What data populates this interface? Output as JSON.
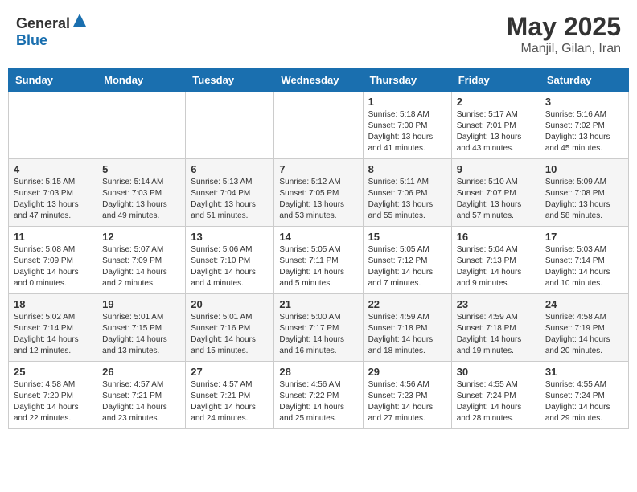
{
  "header": {
    "logo_general": "General",
    "logo_blue": "Blue",
    "month": "May 2025",
    "location": "Manjil, Gilan, Iran"
  },
  "days_of_week": [
    "Sunday",
    "Monday",
    "Tuesday",
    "Wednesday",
    "Thursday",
    "Friday",
    "Saturday"
  ],
  "weeks": [
    [
      {
        "day": "",
        "sunrise": "",
        "sunset": "",
        "daylight": ""
      },
      {
        "day": "",
        "sunrise": "",
        "sunset": "",
        "daylight": ""
      },
      {
        "day": "",
        "sunrise": "",
        "sunset": "",
        "daylight": ""
      },
      {
        "day": "",
        "sunrise": "",
        "sunset": "",
        "daylight": ""
      },
      {
        "day": "1",
        "sunrise": "Sunrise: 5:18 AM",
        "sunset": "Sunset: 7:00 PM",
        "daylight": "Daylight: 13 hours and 41 minutes."
      },
      {
        "day": "2",
        "sunrise": "Sunrise: 5:17 AM",
        "sunset": "Sunset: 7:01 PM",
        "daylight": "Daylight: 13 hours and 43 minutes."
      },
      {
        "day": "3",
        "sunrise": "Sunrise: 5:16 AM",
        "sunset": "Sunset: 7:02 PM",
        "daylight": "Daylight: 13 hours and 45 minutes."
      }
    ],
    [
      {
        "day": "4",
        "sunrise": "Sunrise: 5:15 AM",
        "sunset": "Sunset: 7:03 PM",
        "daylight": "Daylight: 13 hours and 47 minutes."
      },
      {
        "day": "5",
        "sunrise": "Sunrise: 5:14 AM",
        "sunset": "Sunset: 7:03 PM",
        "daylight": "Daylight: 13 hours and 49 minutes."
      },
      {
        "day": "6",
        "sunrise": "Sunrise: 5:13 AM",
        "sunset": "Sunset: 7:04 PM",
        "daylight": "Daylight: 13 hours and 51 minutes."
      },
      {
        "day": "7",
        "sunrise": "Sunrise: 5:12 AM",
        "sunset": "Sunset: 7:05 PM",
        "daylight": "Daylight: 13 hours and 53 minutes."
      },
      {
        "day": "8",
        "sunrise": "Sunrise: 5:11 AM",
        "sunset": "Sunset: 7:06 PM",
        "daylight": "Daylight: 13 hours and 55 minutes."
      },
      {
        "day": "9",
        "sunrise": "Sunrise: 5:10 AM",
        "sunset": "Sunset: 7:07 PM",
        "daylight": "Daylight: 13 hours and 57 minutes."
      },
      {
        "day": "10",
        "sunrise": "Sunrise: 5:09 AM",
        "sunset": "Sunset: 7:08 PM",
        "daylight": "Daylight: 13 hours and 58 minutes."
      }
    ],
    [
      {
        "day": "11",
        "sunrise": "Sunrise: 5:08 AM",
        "sunset": "Sunset: 7:09 PM",
        "daylight": "Daylight: 14 hours and 0 minutes."
      },
      {
        "day": "12",
        "sunrise": "Sunrise: 5:07 AM",
        "sunset": "Sunset: 7:09 PM",
        "daylight": "Daylight: 14 hours and 2 minutes."
      },
      {
        "day": "13",
        "sunrise": "Sunrise: 5:06 AM",
        "sunset": "Sunset: 7:10 PM",
        "daylight": "Daylight: 14 hours and 4 minutes."
      },
      {
        "day": "14",
        "sunrise": "Sunrise: 5:05 AM",
        "sunset": "Sunset: 7:11 PM",
        "daylight": "Daylight: 14 hours and 5 minutes."
      },
      {
        "day": "15",
        "sunrise": "Sunrise: 5:05 AM",
        "sunset": "Sunset: 7:12 PM",
        "daylight": "Daylight: 14 hours and 7 minutes."
      },
      {
        "day": "16",
        "sunrise": "Sunrise: 5:04 AM",
        "sunset": "Sunset: 7:13 PM",
        "daylight": "Daylight: 14 hours and 9 minutes."
      },
      {
        "day": "17",
        "sunrise": "Sunrise: 5:03 AM",
        "sunset": "Sunset: 7:14 PM",
        "daylight": "Daylight: 14 hours and 10 minutes."
      }
    ],
    [
      {
        "day": "18",
        "sunrise": "Sunrise: 5:02 AM",
        "sunset": "Sunset: 7:14 PM",
        "daylight": "Daylight: 14 hours and 12 minutes."
      },
      {
        "day": "19",
        "sunrise": "Sunrise: 5:01 AM",
        "sunset": "Sunset: 7:15 PM",
        "daylight": "Daylight: 14 hours and 13 minutes."
      },
      {
        "day": "20",
        "sunrise": "Sunrise: 5:01 AM",
        "sunset": "Sunset: 7:16 PM",
        "daylight": "Daylight: 14 hours and 15 minutes."
      },
      {
        "day": "21",
        "sunrise": "Sunrise: 5:00 AM",
        "sunset": "Sunset: 7:17 PM",
        "daylight": "Daylight: 14 hours and 16 minutes."
      },
      {
        "day": "22",
        "sunrise": "Sunrise: 4:59 AM",
        "sunset": "Sunset: 7:18 PM",
        "daylight": "Daylight: 14 hours and 18 minutes."
      },
      {
        "day": "23",
        "sunrise": "Sunrise: 4:59 AM",
        "sunset": "Sunset: 7:18 PM",
        "daylight": "Daylight: 14 hours and 19 minutes."
      },
      {
        "day": "24",
        "sunrise": "Sunrise: 4:58 AM",
        "sunset": "Sunset: 7:19 PM",
        "daylight": "Daylight: 14 hours and 20 minutes."
      }
    ],
    [
      {
        "day": "25",
        "sunrise": "Sunrise: 4:58 AM",
        "sunset": "Sunset: 7:20 PM",
        "daylight": "Daylight: 14 hours and 22 minutes."
      },
      {
        "day": "26",
        "sunrise": "Sunrise: 4:57 AM",
        "sunset": "Sunset: 7:21 PM",
        "daylight": "Daylight: 14 hours and 23 minutes."
      },
      {
        "day": "27",
        "sunrise": "Sunrise: 4:57 AM",
        "sunset": "Sunset: 7:21 PM",
        "daylight": "Daylight: 14 hours and 24 minutes."
      },
      {
        "day": "28",
        "sunrise": "Sunrise: 4:56 AM",
        "sunset": "Sunset: 7:22 PM",
        "daylight": "Daylight: 14 hours and 25 minutes."
      },
      {
        "day": "29",
        "sunrise": "Sunrise: 4:56 AM",
        "sunset": "Sunset: 7:23 PM",
        "daylight": "Daylight: 14 hours and 27 minutes."
      },
      {
        "day": "30",
        "sunrise": "Sunrise: 4:55 AM",
        "sunset": "Sunset: 7:24 PM",
        "daylight": "Daylight: 14 hours and 28 minutes."
      },
      {
        "day": "31",
        "sunrise": "Sunrise: 4:55 AM",
        "sunset": "Sunset: 7:24 PM",
        "daylight": "Daylight: 14 hours and 29 minutes."
      }
    ]
  ]
}
